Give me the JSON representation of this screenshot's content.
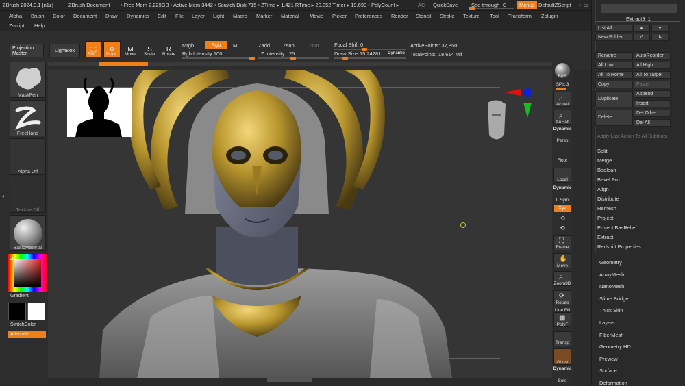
{
  "title": {
    "app": "ZBrush 2024.0.1 [n1z]",
    "doc": "ZBrush Document",
    "stats": "• Free Mem 2.229GB • Active Mem 3442 • Scratch Disk 715 • ZTime ▸ 1.421 RTime ▸ 20.052 Timer ▸ 19.699 • PolyCount ▸",
    "ac": "AC",
    "quicksave": "QuickSave",
    "seethrough": "See-through",
    "seethrough_val": "0",
    "menus": "Menus",
    "script": "DefaultZScript"
  },
  "menus": [
    "Alpha",
    "Brush",
    "Color",
    "Document",
    "Draw",
    "Dynamics",
    "Edit",
    "File",
    "Layer",
    "Light",
    "Macro",
    "Marker",
    "Material",
    "Movie",
    "Picker",
    "Preferences",
    "Render",
    "Stencil",
    "Stroke",
    "Texture",
    "Tool",
    "Transform",
    "Zplugin"
  ],
  "menus2": [
    "Zscript",
    "Help"
  ],
  "toolbar": {
    "projection_master": "Projection Master",
    "lightbox": "LightBox",
    "edit": "Edit",
    "draw": "Draw",
    "move": "Move",
    "scale": "Scale",
    "rotate": "Rotate",
    "mrgb": "Mrgb",
    "rgb": "Rgb",
    "m": "M",
    "rgb_intensity": "Rgb Intensity 100",
    "zadd": "Zadd",
    "zsub": "Zsub",
    "zcut": "Zcut",
    "z_intensity": "Z Intensity",
    "z_intensity_val": "25",
    "focal_shift": "Focal Shift",
    "focal_shift_val": "0",
    "draw_size": "Draw Size",
    "draw_size_val": "15.24281",
    "dynamic": "Dynamic",
    "active_points": "ActivePoints: 37,850",
    "total_points": "TotalPoints: 18.614 Mil"
  },
  "leftshelf": {
    "maskpen": "MaskPen",
    "freehand": "FreeHand",
    "alpha_off": "Alpha Off",
    "texture_off": "Texture Off",
    "basic_material": "BasicMaterial",
    "gradient": "Gradient",
    "switchcolor": "SwitchColor",
    "alternate": "Alternate"
  },
  "rightshelf": {
    "bpr": "BPR",
    "spix": "SPix 3",
    "actual": "Actual",
    "aahalf": "AAHalf",
    "dynamic": "Dynamic",
    "persp": "Persp",
    "floor": "Floor",
    "local": "Local",
    "lsym": "L.Sym",
    "xyz": "Xyz",
    "frame": "Frame",
    "move": "Move",
    "zoom3d": "Zoom3D",
    "rotate": "Rotate",
    "linefill": "Line Fill",
    "polyf": "PolyF",
    "transp": "Transp",
    "ghost": "Ghost",
    "solo": "Solo"
  },
  "tray": {
    "extract_name": "Extract9_1",
    "list_all": "List All",
    "new_folder": "New Folder",
    "rename": "Rename",
    "autoreorder": "AutoReorder",
    "all_low": "All Low",
    "all_high": "All High",
    "all_to_home": "All To Home",
    "all_to_target": "All To Target",
    "copy": "Copy",
    "paste": "Paste",
    "duplicate": "Duplicate",
    "append": "Append",
    "insert": "Insert",
    "delete": "Delete",
    "del_other": "Del Other",
    "del_all": "Del All",
    "apply_last": "Apply Last Action To All Subtools",
    "actions": [
      "Split",
      "Merge",
      "Boolean",
      "Bevel Pro",
      "Align",
      "Distribute",
      "Remesh",
      "Project",
      "Project BasRelief",
      "Extract",
      "Redshift Properties"
    ],
    "subpalettes": [
      "Geometry",
      "ArrayMesh",
      "NanoMesh",
      "Slime Bridge",
      "Thick Skin",
      "Layers",
      "FiberMesh",
      "Geometry HD",
      "Preview",
      "Surface",
      "Deformation"
    ]
  },
  "colors": {
    "accent": "#f07f1a",
    "bg": "#2b2b2b",
    "gold": "#b8952e",
    "skin": "#6f7383"
  }
}
